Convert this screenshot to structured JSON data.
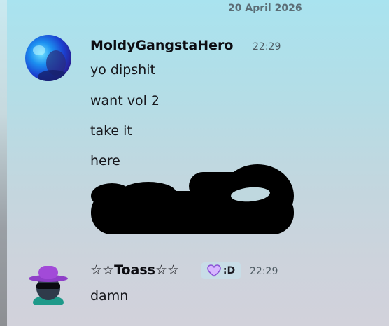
{
  "divider": {
    "date": "20 April 2026"
  },
  "messages": [
    {
      "author": "MoldyGangstaHero",
      "time": "22:29",
      "avatar_icon": "user-avatar-photo",
      "lines": [
        "yo dipshit",
        "want vol 2",
        "take it",
        "here"
      ]
    },
    {
      "author": "☆☆Toass☆☆",
      "time": "22:29",
      "avatar_icon": "hat-sunglasses-avatar",
      "tag": ":D",
      "tag_icon": "purple-heart-icon",
      "lines": [
        "damn"
      ]
    }
  ],
  "colors": {
    "accent_purple": "#9b4fd1",
    "tag_bg": "#c8dde7",
    "redaction": "#000000"
  }
}
